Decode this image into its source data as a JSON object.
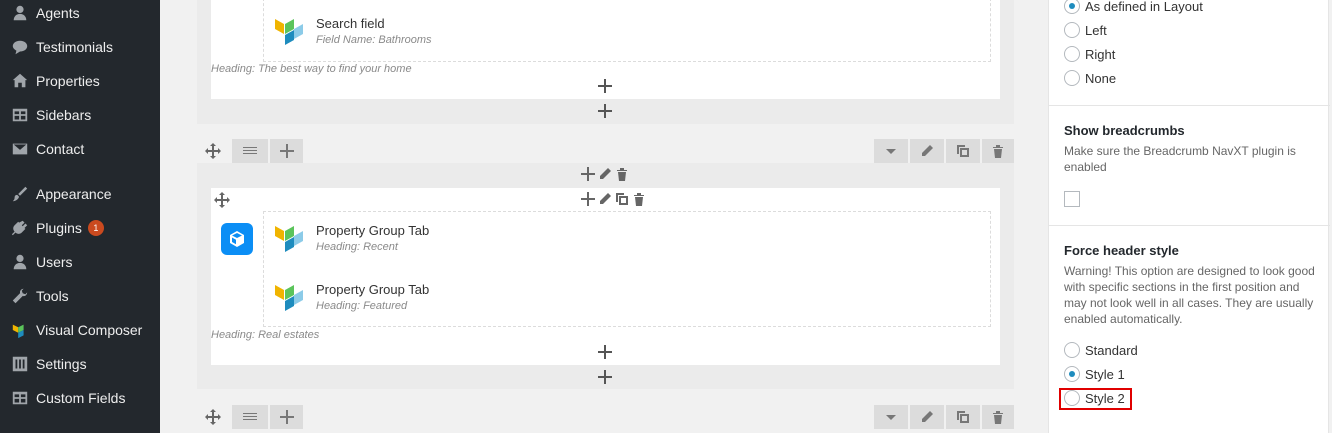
{
  "sidebar": {
    "items": [
      {
        "label": "Agents",
        "icon": "user-icon"
      },
      {
        "label": "Testimonials",
        "icon": "speech-bubble-icon"
      },
      {
        "label": "Properties",
        "icon": "house-icon"
      },
      {
        "label": "Sidebars",
        "icon": "table-icon"
      },
      {
        "label": "Contact",
        "icon": "envelope-icon"
      },
      {
        "label": "Appearance",
        "icon": "paintbrush-icon"
      },
      {
        "label": "Plugins",
        "icon": "plug-icon",
        "badge": "1"
      },
      {
        "label": "Users",
        "icon": "user-icon"
      },
      {
        "label": "Tools",
        "icon": "wrench-icon"
      },
      {
        "label": "Visual Composer",
        "icon": "visual-composer-icon"
      },
      {
        "label": "Settings",
        "icon": "sliders-icon"
      },
      {
        "label": "Custom Fields",
        "icon": "table-icon"
      }
    ]
  },
  "editor": {
    "block1": {
      "element_title": "Search field",
      "element_sub": "Field Name: Bathrooms",
      "heading_note": "Heading: The best way to find your home"
    },
    "block2": {
      "elements": [
        {
          "title": "Property Group Tab",
          "sub": "Heading: Recent"
        },
        {
          "title": "Property Group Tab",
          "sub": "Heading: Featured"
        }
      ],
      "heading_note": "Heading: Real estates"
    }
  },
  "panel": {
    "layout_options": [
      {
        "label": "As defined in Layout",
        "checked": true
      },
      {
        "label": "Left",
        "checked": false
      },
      {
        "label": "Right",
        "checked": false
      },
      {
        "label": "None",
        "checked": false
      }
    ],
    "breadcrumbs": {
      "title": "Show breadcrumbs",
      "desc": "Make sure the Breadcrumb NavXT plugin is enabled"
    },
    "header_style": {
      "title": "Force header style",
      "desc": "Warning! This option are designed to look good with specific sections in the first position and may not look well in all cases. They are usually enabled automatically.",
      "options": [
        {
          "label": "Standard",
          "checked": false
        },
        {
          "label": "Style 1",
          "checked": true
        },
        {
          "label": "Style 2",
          "checked": false
        }
      ]
    }
  },
  "colors": {
    "sidebar_bg": "#23282d",
    "accent": "#1e8cbe",
    "highlight": "#e00000",
    "badge": "#ca4a1f"
  }
}
